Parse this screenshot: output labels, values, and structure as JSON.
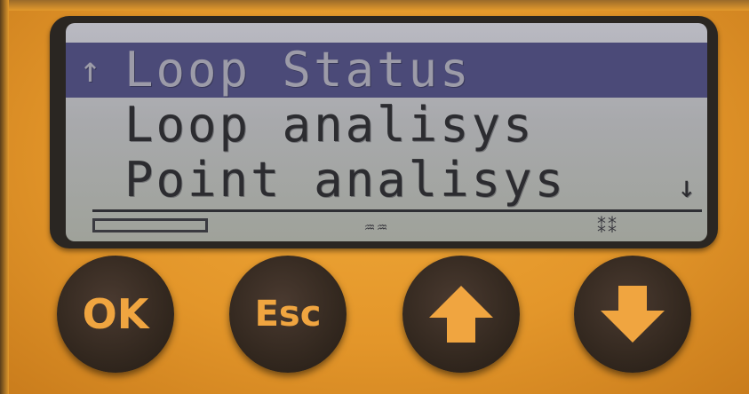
{
  "display": {
    "rows": [
      {
        "arrow": "↑",
        "text": "Loop Status",
        "selected": true
      },
      {
        "arrow": "",
        "text": "Loop analisys",
        "selected": false
      },
      {
        "arrow": "",
        "text": "Point analisys",
        "selected": false,
        "right_arrow": "↓"
      }
    ],
    "softkeys": {
      "middle": "♒♒",
      "right": "⁑⁑"
    }
  },
  "buttons": {
    "ok": "OK",
    "esc": "Esc",
    "up": "up-arrow-icon",
    "down": "down-arrow-icon"
  },
  "colors": {
    "housing": "#e39a2c",
    "button": "#33281f",
    "button_label": "#f0a540",
    "lcd": "#a8a9ac",
    "lcd_highlight": "#4b4a78"
  }
}
